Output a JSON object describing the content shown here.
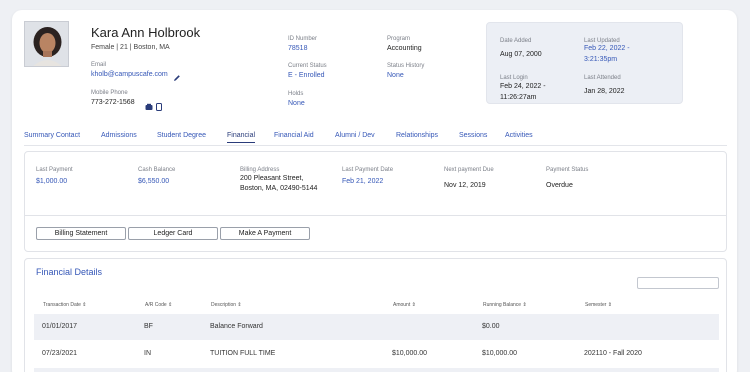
{
  "profile": {
    "name": "Kara Ann Holbrook",
    "demographics": "Female | 21 | Boston, MA",
    "email_label": "Email",
    "email": "kholb@campuscafe.com",
    "phone_label": "Mobile Phone",
    "phone": "773-272-1568",
    "id_label": "ID Number",
    "id": "78518",
    "status_label": "Current Status",
    "status": "E - Enrolled",
    "holds_label": "Holds",
    "holds": "None",
    "program_label": "Program",
    "program": "Accounting",
    "status_history_label": "Status History",
    "status_history": "None"
  },
  "dates": {
    "added_label": "Date Added",
    "added": "Aug 07, 2000",
    "updated_label": "Last Updated",
    "updated_line1": "Feb 22, 2022 -",
    "updated_line2": "3:21:35pm",
    "login_label": "Last Login",
    "login_line1": "Feb 24, 2022 -",
    "login_line2": "11:26:27am",
    "attended_label": "Last Attended",
    "attended": "Jan 28, 2022"
  },
  "tabs": [
    {
      "label": "Summary Contact"
    },
    {
      "label": "Admissions"
    },
    {
      "label": "Student Degree"
    },
    {
      "label": "Financial"
    },
    {
      "label": "Financial Aid"
    },
    {
      "label": "Alumni / Dev"
    },
    {
      "label": "Relationships"
    },
    {
      "label": "Sessions"
    },
    {
      "label": "Activities"
    }
  ],
  "active_tab": "Financial",
  "financial": {
    "last_payment_label": "Last Payment",
    "last_payment": "$1,000.00",
    "cash_balance_label": "Cash Balance",
    "cash_balance": "$6,550.00",
    "billing_address_label": "Billing Address",
    "billing_address_line1": "200 Pleasant Street,",
    "billing_address_line2": "Boston, MA, 02490-5144",
    "last_payment_date_label": "Last Payment Date",
    "last_payment_date": "Feb 21, 2022",
    "next_payment_label": "Next payment Due",
    "next_payment": "Nov 12, 2019",
    "payment_status_label": "Payment Status",
    "payment_status": "Overdue"
  },
  "buttons": {
    "billing_statement": "Billing Statement",
    "ledger_card": "Ledger Card",
    "make_payment": "Make A Payment"
  },
  "details": {
    "title": "Financial Details",
    "columns": [
      "Transaction Date",
      "A/R Code",
      "Description",
      "Amount",
      "Running Balance",
      "Semester"
    ],
    "rows": [
      {
        "date": "01/01/2017",
        "code": "BF",
        "description": "Balance Forward",
        "amount": "",
        "balance": "$0.00",
        "semester": ""
      },
      {
        "date": "07/23/2021",
        "code": "IN",
        "description": "TUITION FULL TIME",
        "amount": "$10,000.00",
        "balance": "$10,000.00",
        "semester": "202110 - Fall 2020"
      }
    ]
  },
  "colors": {
    "accent": "#3557b7",
    "background": "#eef0f4",
    "dates_panel": "#eceff5"
  }
}
